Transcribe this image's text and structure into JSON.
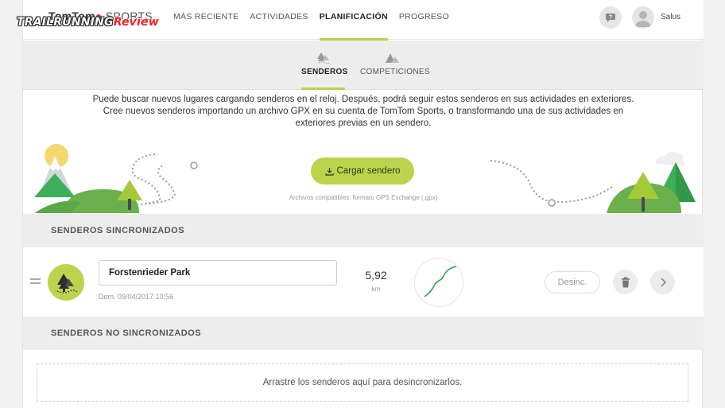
{
  "brand": {
    "logo_bold": "TomTom",
    "logo_thin": "SPORTS",
    "watermark_main": "TRAILRUNNING",
    "watermark_accent": "Review"
  },
  "nav": {
    "items": [
      {
        "label": "MÁS RECIENTE",
        "active": false
      },
      {
        "label": "ACTIVIDADES",
        "active": false
      },
      {
        "label": "PLANIFICACIÓN",
        "active": true
      },
      {
        "label": "PROGRESO",
        "active": false
      }
    ],
    "help_icon": "question-bubble-icon",
    "avatar_icon": "user-avatar-icon",
    "user_name": "Salus"
  },
  "subtabs": [
    {
      "label": "SENDEROS",
      "icon": "trail-icon",
      "active": true
    },
    {
      "label": "COMPETICIONES",
      "icon": "mountain-icon",
      "active": false
    }
  ],
  "intro": {
    "line1": "Puede buscar nuevos lugares cargando senderos en el reloj. Después, podrá seguir estos senderos en sus actividades en exteriores.",
    "line2": "Cree nuevos senderos importando un archivo GPX en su cuenta de TomTom Sports, o transformando una de sus actividades en",
    "line3": "exteriores previas en un sendero."
  },
  "upload": {
    "label": "Cargar sendero",
    "icon": "upload-icon",
    "compat": "Archivos compatibles: formato GPS Exchange (.gpx)"
  },
  "synced": {
    "header": "SENDEROS SINCRONIZADOS",
    "tracks": [
      {
        "name": "Forstenrieder Park",
        "date": "Dom. 09/04/2017 10:56",
        "distance": "5,92",
        "unit": "km",
        "desync_label": "Desinc."
      }
    ]
  },
  "unsynced": {
    "header": "SENDEROS NO SINCRONIZADOS",
    "dropzone": "Arrastre los senderos aquí para desincronizarlos."
  },
  "colors": {
    "accent": "#bcd34e",
    "header_bg": "#ededed",
    "tree_green": "#3fae5a",
    "sun": "#f5d76e"
  }
}
